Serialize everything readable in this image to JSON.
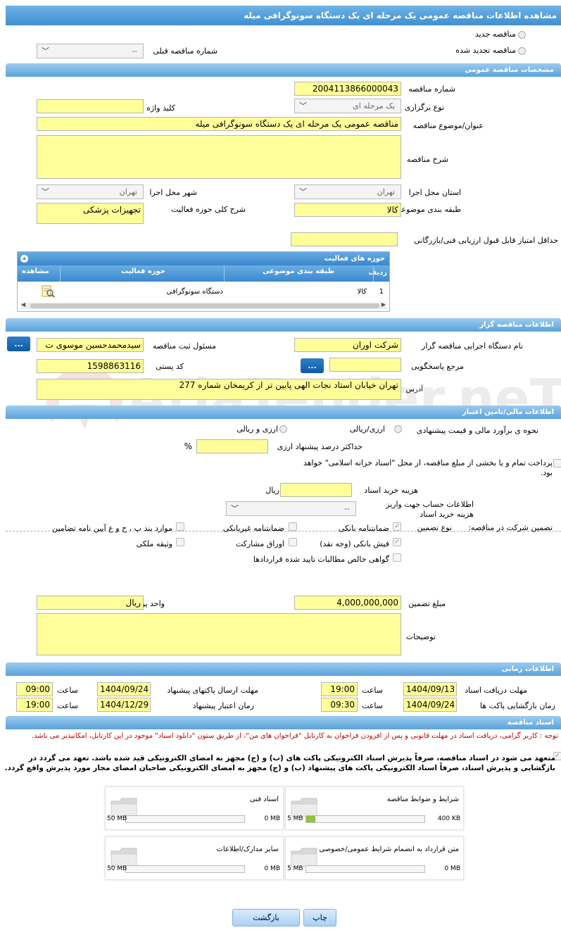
{
  "header": {
    "title": "مشاهده اطلاعات مناقصه عمومی یک مرحله ای یک دستگاه سونوگرافی میله"
  },
  "mode": {
    "new_label": "مناقصه جدید",
    "renew_label": "مناقصه تجدید شده",
    "prev_number_label": "شماره مناقصه قبلی",
    "prev_number_value": "--"
  },
  "general": {
    "section_title": "مشخصات مناقصه عمومی",
    "number_label": "شماره مناقصه",
    "number_value": "2004113866000043",
    "type_label": "نوع برگزاری",
    "type_value": "یک مرحله ای",
    "keyword_label": "کلید واژه",
    "keyword_value": "",
    "subject_label": "عنوان/موضوع مناقصه",
    "subject_value": "مناقصه عمومی یک مرحله ای یک دستگاه سونوگرافی میله",
    "desc_label": "شرح مناقصه",
    "desc_value": "",
    "province_label": "استان محل اجرا",
    "province_value": "تهران",
    "city_label": "شهر محل اجرا",
    "city_value": "تهران",
    "category_label": "طبقه بندی موضوعی",
    "category_value": "کالا",
    "scope_label": "شرح کلی حوزه فعالیت",
    "scope_value": "تجهیزات پزشکی",
    "min_score_label": "حداقل امتیاز قابل قبول ارزیابی فنی/بازرگانی",
    "min_score_value": ""
  },
  "activity": {
    "title": "حوزه های فعالیت",
    "columns": [
      "ردیف",
      "طبقه بندی موضوعی",
      "حوزه فعالیت",
      "مشاهده"
    ],
    "rows": [
      {
        "index": "1",
        "category": "کالا",
        "field": "دستگاه سونوگرافی"
      }
    ]
  },
  "organizer": {
    "section_title": "اطلاعات مناقصه گزار",
    "org_label": "نام دستگاه اجرایی مناقصه گزار",
    "org_value": "شرکت اوران",
    "registrar_label": "مسئول ثبت مناقصه",
    "registrar_value": "سیدمحمدحسین موسوی ت",
    "ref_label": "مرجع پاسخگویی",
    "ref_value": "",
    "postal_label": "کد پستی",
    "postal_value": "1598863116",
    "address_label": "آدرس",
    "address_value": "تهران خیابان استاد نجات الهی پایین تر از کریمخان شماره 277",
    "more_btn": "..."
  },
  "financial": {
    "section_title": "اطلاعات مالی/تامین اعتبار",
    "estimate_label": "نحوه ی برآورد مالی و قیمت پیشنهادی",
    "opt_currency": "ارزی/ریالی",
    "opt_both": "ارزی و ریالی",
    "max_percent_label": "حداکثر درصد پیشنهاد ارزی",
    "max_percent_value": "",
    "percent_sign": "%",
    "treasury_text": "پرداخت تمام و یا بخشی از مبلغ مناقصه، از محل \"اسناد خزانه اسلامی\" خواهد بود.",
    "doc_cost_label": "هزینه خرید اسناد",
    "doc_cost_value": "",
    "doc_cost_unit": "ریال",
    "account_label": "اطلاعات حساب جهت واریز هزینه خرید اسناد",
    "account_value": "--"
  },
  "guarantee": {
    "main_label": "تضمین شرکت در مناقصه:",
    "type_label": "نوع تضمین",
    "options": [
      "ضمانتنامه بانکی",
      "ضمانتنامه غیربانکی",
      "موارد بند پ ، ح و ع آیین نامه تضامین",
      "فیش بانکی (وجه نقد)",
      "اوراق مشارکت",
      "وثیقه ملکی",
      "گواهی خالص مطالبات تایید شده قراردادها"
    ],
    "amount_label": "مبلغ تضمین",
    "amount_value": "4,000,000,000",
    "currency_label": "واحد پول",
    "currency_value": "ریال",
    "notes_label": "توضیحات",
    "notes_value": ""
  },
  "timing": {
    "section_title": "اطلاعات زمانی",
    "receive_label": "مهلت دریافت اسناد",
    "receive_date": "1404/09/13",
    "receive_time": "19:00",
    "send_label": "مهلت ارسال پاکتهای پیشنهاد",
    "send_date": "1404/09/24",
    "send_time": "09:00",
    "open_label": "زمان بازگشایی پاکت ها",
    "open_date": "1404/09/24",
    "open_time": "09:30",
    "valid_label": "زمان اعتبار پیشنهاد",
    "valid_date": "1404/12/29",
    "valid_time": "19:00",
    "time_label": "ساعت"
  },
  "documents": {
    "section_title": "اسناد مناقصه",
    "notice": "توجه : کاربر گرامی، دریافت اسناد در مهلت قانونی و پس از افزودن فراخوان به کارتابل \"فراخوان های من\"، از طریق ستون \"دانلود اسناد\" موجود در این کارتابل، امکانپذیر می باشد.",
    "commit": "متعهد می شود در اسناد مناقصه، صرفاً پذیرش اسناد الکترونیکی پاکت های (ب) و (ج) مجهز به امضای الکترونیکی قید شده باشد. تعهد می گردد در بازگشایی و پذیرش اسناد، صرفاً اسناد الکترونیکی پاکت های پیشنهاد (ب) و (ج) مجهز به امضای الکترونیکی صاحبان امضای مجاز مورد پذیرش واقع گردد.",
    "items": [
      {
        "title": "شرایط و ضوابط مناقصه",
        "used": "400 KB",
        "max": "5 MB",
        "fill": 0.08
      },
      {
        "title": "اسناد فنی",
        "used": "0 MB",
        "max": "50 MB",
        "fill": 0
      },
      {
        "title": "متن قرارداد به انضمام شرایط عمومی/خصوصی",
        "used": "0 MB",
        "max": "5 MB",
        "fill": 0
      },
      {
        "title": "سایر مدارک/اطلاعات",
        "used": "0 MB",
        "max": "50 MB",
        "fill": 0
      }
    ]
  },
  "footer": {
    "back_label": "بازگشت",
    "print_label": "چاپ"
  },
  "watermark": "AriaTender.neT",
  "colors": {
    "accent": "#3f8fd0",
    "input_bg": "#ffff99",
    "notice": "#c00000"
  }
}
